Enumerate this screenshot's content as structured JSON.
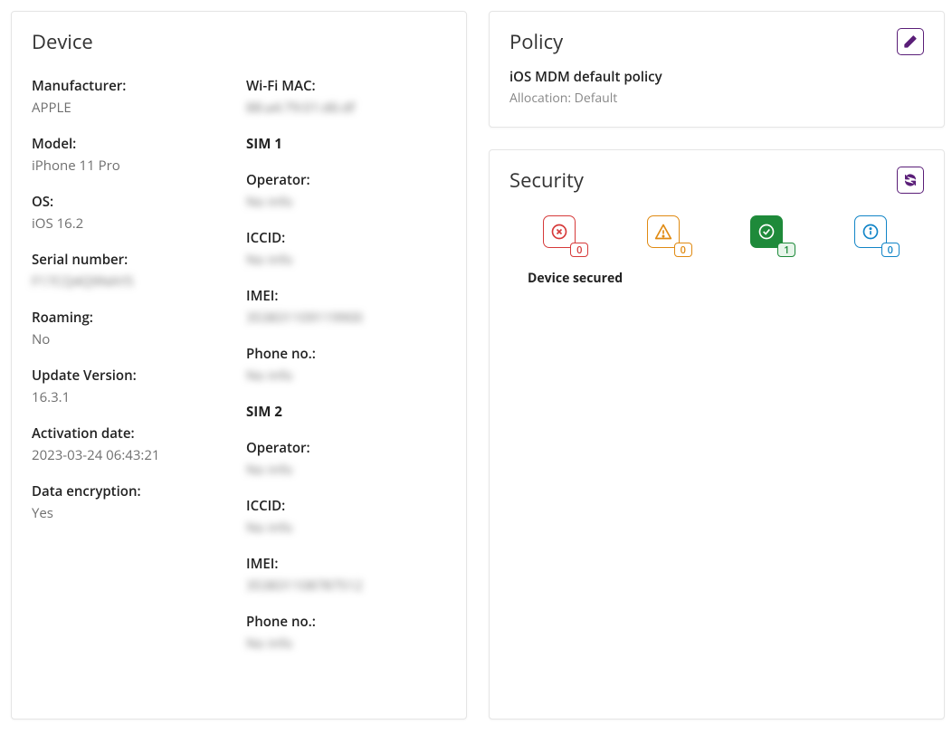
{
  "device": {
    "title": "Device",
    "left": [
      {
        "label": "Manufacturer:",
        "value": "APPLE"
      },
      {
        "label": "Model:",
        "value": "iPhone 11 Pro"
      },
      {
        "label": "OS:",
        "value": "iOS 16.2"
      },
      {
        "label": "Serial number:",
        "value": "F17CQ4Q9NAY5",
        "blur": true
      },
      {
        "label": "Roaming:",
        "value": "No"
      },
      {
        "label": "Update Version:",
        "value": "16.3.1"
      },
      {
        "label": "Activation date:",
        "value": "2023-03-24 06:43:21"
      },
      {
        "label": "Data encryption:",
        "value": "Yes"
      }
    ],
    "right_top": [
      {
        "label": "Wi-Fi MAC:",
        "value": "88:a4:79:01:d6:df",
        "blur": true
      }
    ],
    "sim1_label": "SIM 1",
    "sim1": [
      {
        "label": "Operator:",
        "value": "No info",
        "blur": true
      },
      {
        "label": "ICCID:",
        "value": "No info",
        "blur": true
      },
      {
        "label": "IMEI:",
        "value": "353831109119900",
        "blur": true
      },
      {
        "label": "Phone no.:",
        "value": "No info",
        "blur": true
      }
    ],
    "sim2_label": "SIM 2",
    "sim2": [
      {
        "label": "Operator:",
        "value": "No info",
        "blur": true
      },
      {
        "label": "ICCID:",
        "value": "No info",
        "blur": true
      },
      {
        "label": "IMEI:",
        "value": "353831108787512",
        "blur": true
      },
      {
        "label": "Phone no.:",
        "value": "No info",
        "blur": true
      }
    ]
  },
  "policy": {
    "title": "Policy",
    "name": "iOS MDM default policy",
    "allocation": "Allocation: Default"
  },
  "security": {
    "title": "Security",
    "counts": {
      "error": "0",
      "warning": "0",
      "ok": "1",
      "info": "0"
    },
    "status": "Device secured"
  }
}
